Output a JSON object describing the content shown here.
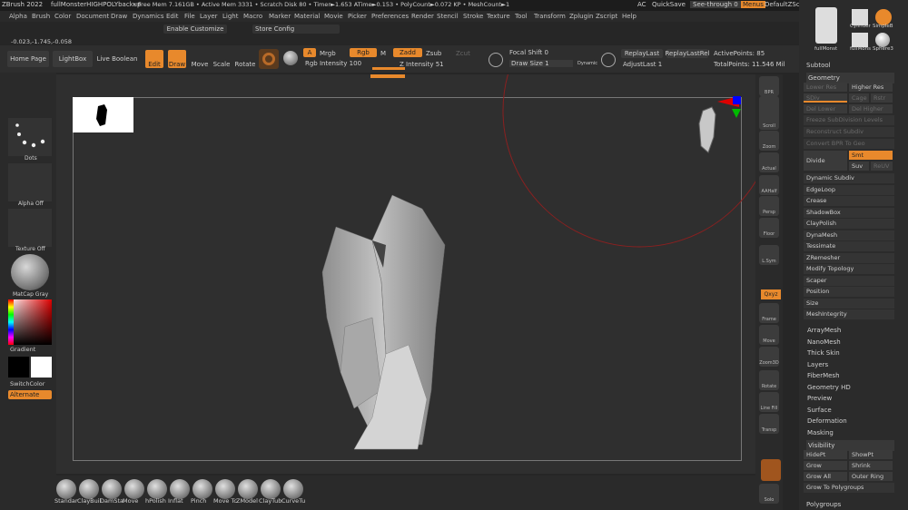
{
  "title": {
    "app": "ZBrush 2022",
    "doc": "fullMonsterHIGHPOLYbackup",
    "stats": "• Free Mem 7.161GB • Active Mem 3331 • Scratch Disk 80 • Timer►1.653 ATime►0.153 • PolyCount►0.072 KP • MeshCount►1",
    "ac": "AC",
    "quicksave": "QuickSave",
    "seethrough": "See-through  0",
    "menus": "Menus",
    "defscript": "DefaultZScript"
  },
  "menu": [
    "Alpha",
    "Brush",
    "Color",
    "Document",
    "Draw",
    "Dynamics",
    "Edit",
    "File",
    "Layer",
    "Light",
    "Macro",
    "Marker",
    "Material",
    "Movie",
    "Picker",
    "Preferences",
    "Render",
    "Stencil",
    "Stroke",
    "Texture",
    "Tool",
    "Transform",
    "Zplugin",
    "Zscript",
    "Help"
  ],
  "customize": {
    "enable": "Enable Customize",
    "store": "Store Config"
  },
  "coords": "-0.023,-1.745,-0.058",
  "shelf": {
    "home": "Home Page",
    "lightbox": "LightBox",
    "liveboolean": "Live Boolean",
    "edit": "Edit",
    "draw": "Draw",
    "move": "Move",
    "scale": "Scale",
    "rotate": "Rotate"
  },
  "mat": {
    "a": "A",
    "mrgb": "Mrgb",
    "rgb": "Rgb",
    "m": "M",
    "zadd": "Zadd",
    "zsub": "Zsub",
    "zcut": "Zcut",
    "rgbint": "Rgb Intensity 100",
    "zint": "Z Intensity 51"
  },
  "focal": {
    "shift": "Focal Shift 0",
    "draw": "Draw Size 1",
    "dynamic": "Dynamic"
  },
  "replay": {
    "last": "ReplayLast",
    "lastrel": "ReplayLastRel",
    "adjust": "AdjustLast 1"
  },
  "points": {
    "active": "ActivePoints: 85",
    "total": "TotalPoints: 11.546 Mil"
  },
  "left": {
    "dots": "Dots",
    "alpha": "Alpha Off",
    "texture": "Texture Off",
    "matcap": "MatCap Gray",
    "gradient": "Gradient",
    "switch": "SwitchColor",
    "alternate": "Alternate"
  },
  "tools": [
    "BPR",
    "SPix 3",
    "Scroll",
    "Zoom",
    "Actual",
    "AAHalf",
    "Persp",
    "Floor",
    "L.Sym",
    "Qxyz",
    "Frame",
    "Move",
    "Zoom3D",
    "Rotate",
    "Line Fill",
    "Transp",
    "Ghost",
    "Solo"
  ],
  "brushes": [
    "Standar",
    "ClayBuil",
    "DamSta",
    "Move",
    "hPolish",
    "Inflat",
    "Pinch",
    "Move Tc",
    "ZModel",
    "ClayTub",
    "CurveTu"
  ],
  "right": {
    "thumbs": [
      "fullMonst",
      "Cylinder",
      "SimpleB",
      "fullMons",
      "Sphere3"
    ],
    "subtool": "Subtool",
    "geometry": "Geometry",
    "lowerres": "Lower Res",
    "higherres": "Higher Res",
    "sdiv": "SDiv",
    "cage": "Cage",
    "rstr": "Rstr",
    "dellower": "Del Lower",
    "delhigher": "Del Higher",
    "freeze": "Freeze SubDivision Levels",
    "reconstruct": "Reconstruct Subdiv",
    "convert": "Convert BPR To Geo",
    "divide": "Divide",
    "smt": "Smt",
    "suv": "Suv",
    "reuv": "ReUV",
    "items": [
      "Dynamic Subdiv",
      "EdgeLoop",
      "Crease",
      "ShadowBox",
      "ClayPolish",
      "DynaMesh",
      "Tessimate",
      "ZRemesher",
      "Modify Topology",
      "Scaper",
      "Position",
      "Size",
      "MeshIntegrity"
    ],
    "sections": [
      "ArrayMesh",
      "NanoMesh",
      "Thick Skin",
      "Layers",
      "FiberMesh",
      "Geometry HD",
      "Preview",
      "Surface",
      "Deformation",
      "Masking"
    ],
    "visibility": "Visibility",
    "hidept": "HidePt",
    "showpt": "ShowPt",
    "grow": "Grow",
    "shrink": "Shrink",
    "growall": "Grow All",
    "outerring": "Outer Ring",
    "growpoly": "Grow To Polygroups",
    "polygroups": "Polygroups"
  }
}
